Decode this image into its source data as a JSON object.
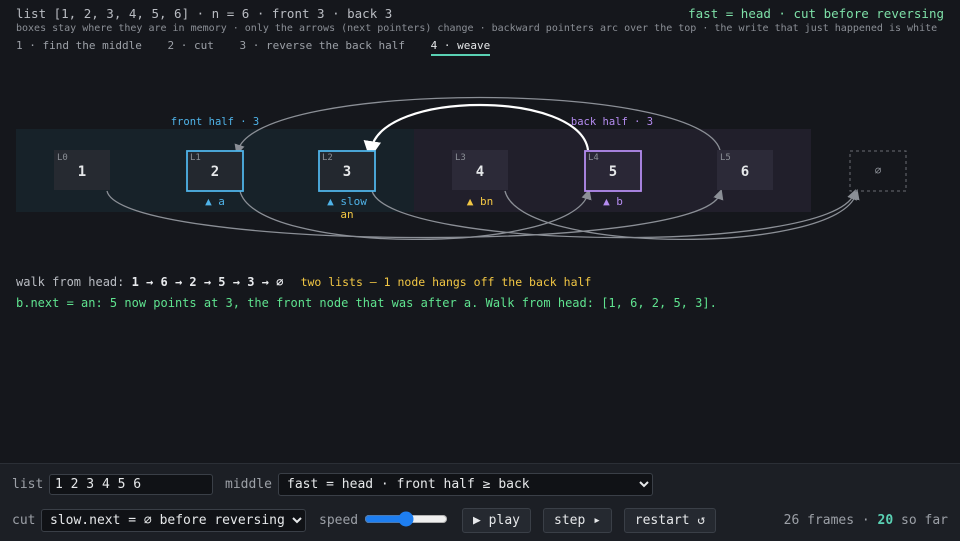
{
  "header": {
    "title": "list [1, 2, 3, 4, 5, 6] · n = 6 · front 3 · back 3",
    "mode": "fast = head · cut before reversing",
    "subtitle": "boxes stay where they are in memory · only the arrows (next pointers) change · backward pointers arc over the top · the write that just happened is white"
  },
  "steps": [
    {
      "label": "1 · find the middle",
      "active": false
    },
    {
      "label": "2 · cut",
      "active": false
    },
    {
      "label": "3 · reverse the back half",
      "active": false
    },
    {
      "label": "4 · weave",
      "active": true
    }
  ],
  "halves": {
    "front": "front half · 3",
    "back": "back half · 3"
  },
  "nodes": [
    {
      "tag": "L0",
      "value": "1"
    },
    {
      "tag": "L1",
      "value": "2"
    },
    {
      "tag": "L2",
      "value": "3"
    },
    {
      "tag": "L3",
      "value": "4"
    },
    {
      "tag": "L4",
      "value": "5"
    },
    {
      "tag": "L5",
      "value": "6"
    }
  ],
  "null_symbol": "∅",
  "pointers": {
    "a": "▲ a",
    "slow": "▲ slow",
    "an": "an",
    "bn": "▲ bn",
    "b": "▲ b"
  },
  "walk": {
    "prefix": "walk from head:",
    "path": "1 → 6 → 2 → 5 → 3 → ∅",
    "note": "two lists — 1 node hangs off the back half"
  },
  "explanation": "b.next = an: 5 now points at 3, the front node that was after a. Walk from head: [1, 6, 2, 5, 3].",
  "controls": {
    "list_label": "list",
    "list_value": "1 2 3 4 5 6",
    "middle_label": "middle",
    "middle_value": "fast = head · front half ≥ back",
    "cut_label": "cut",
    "cut_value": "slow.next = ∅ before reversing",
    "speed_label": "speed",
    "speed_value": 50,
    "play": "▶ play",
    "step": "step ▸",
    "restart": "restart ↺",
    "frames_total": "26 frames ·",
    "frames_current": "20",
    "frames_suffix": "so far"
  },
  "colors": {
    "front": "#4fb3e8",
    "back": "#b58cf0",
    "ptr_yellow": "#f2c744",
    "accent_green": "#5fe38f"
  }
}
